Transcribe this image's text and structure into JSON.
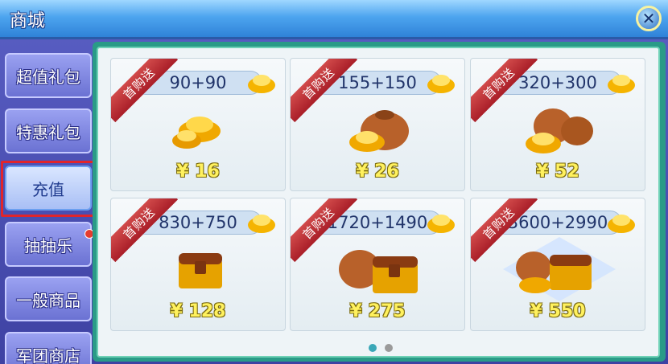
{
  "window": {
    "title": "商城",
    "close_icon": "close-icon"
  },
  "sidebar": {
    "items": [
      {
        "label": "超值礼包",
        "active": false
      },
      {
        "label": "特惠礼包",
        "active": false
      },
      {
        "label": "充值",
        "active": true
      },
      {
        "label": "抽抽乐",
        "active": false,
        "notification": true
      },
      {
        "label": "一般商品",
        "active": false
      },
      {
        "label": "军团商店",
        "active": false
      }
    ]
  },
  "recharge": {
    "badge": "首购送",
    "items": [
      {
        "amount": "90+90",
        "price": "¥ 16",
        "icon": "gold-ingots-icon"
      },
      {
        "amount": "155+150",
        "price": "¥ 26",
        "icon": "money-bag-icon"
      },
      {
        "amount": "320+300",
        "price": "¥ 52",
        "icon": "money-bags-icon"
      },
      {
        "amount": "830+750",
        "price": "¥ 128",
        "icon": "treasure-chest-icon"
      },
      {
        "amount": "1720+1490",
        "price": "¥ 275",
        "icon": "bag-and-chest-icon"
      },
      {
        "amount": "3600+2990",
        "price": "¥ 550",
        "icon": "treasure-pile-icon"
      }
    ]
  },
  "pagination": {
    "pages": 2,
    "current": 1
  },
  "colors": {
    "price_text": "#fff15e",
    "badge_red": "#b8252c",
    "panel_teal": "#2a9b87",
    "active_page": "#3aa7b7"
  }
}
